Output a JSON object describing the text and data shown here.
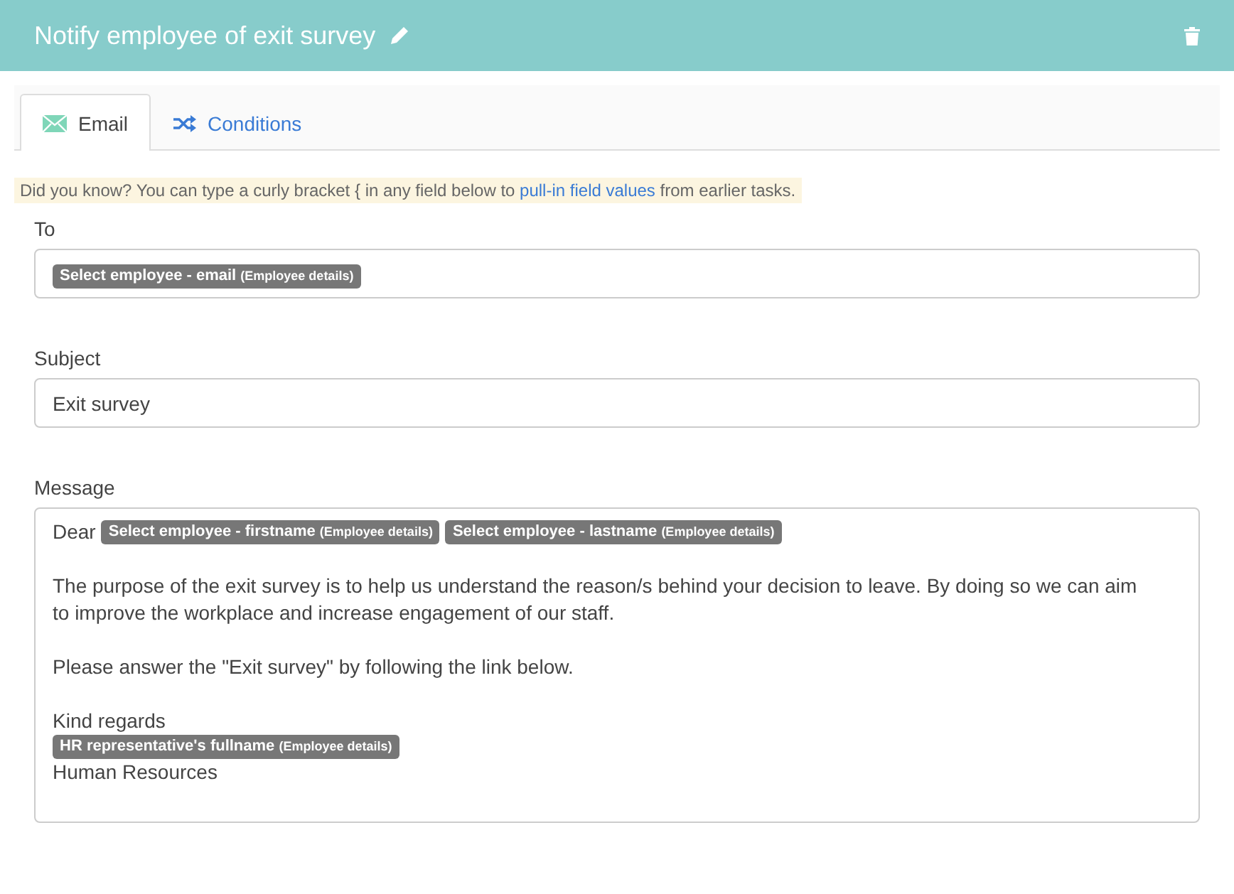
{
  "header": {
    "title": "Notify employee of exit survey"
  },
  "tabs": [
    {
      "label": "Email",
      "kind": "email",
      "selected": true
    },
    {
      "label": "Conditions",
      "kind": "conditions",
      "selected": false
    }
  ],
  "hint": {
    "before": "Did you know? You can type a curly bracket { in any field below to ",
    "link": "pull-in field values",
    "after": " from earlier tasks."
  },
  "to": {
    "label": "To",
    "tokens": [
      {
        "label": "Select employee - email",
        "source": "(Employee details)"
      }
    ]
  },
  "subject": {
    "label": "Subject",
    "value": "Exit survey"
  },
  "message": {
    "label": "Message",
    "blocks": [
      [
        [
          {
            "kind": "text",
            "text": "Dear"
          },
          {
            "kind": "token",
            "label": "Select employee - firstname",
            "source": "(Employee details)"
          },
          {
            "kind": "token",
            "label": "Select employee - lastname",
            "source": "(Employee details)"
          }
        ]
      ],
      [
        [
          {
            "kind": "text",
            "text": "The purpose of the exit survey is to help us understand the reason/s behind your decision to leave. By doing so we can aim to improve the workplace and increase engagement of our staff."
          }
        ]
      ],
      [
        [
          {
            "kind": "text",
            "text": "Please answer the \"Exit survey\" by following the link below."
          }
        ]
      ],
      [
        [
          {
            "kind": "text",
            "text": "Kind regards"
          }
        ],
        [
          {
            "kind": "token",
            "label": "HR representative's fullname",
            "source": "(Employee details)"
          }
        ],
        [
          {
            "kind": "text",
            "text": "Human Resources"
          }
        ]
      ]
    ]
  }
}
